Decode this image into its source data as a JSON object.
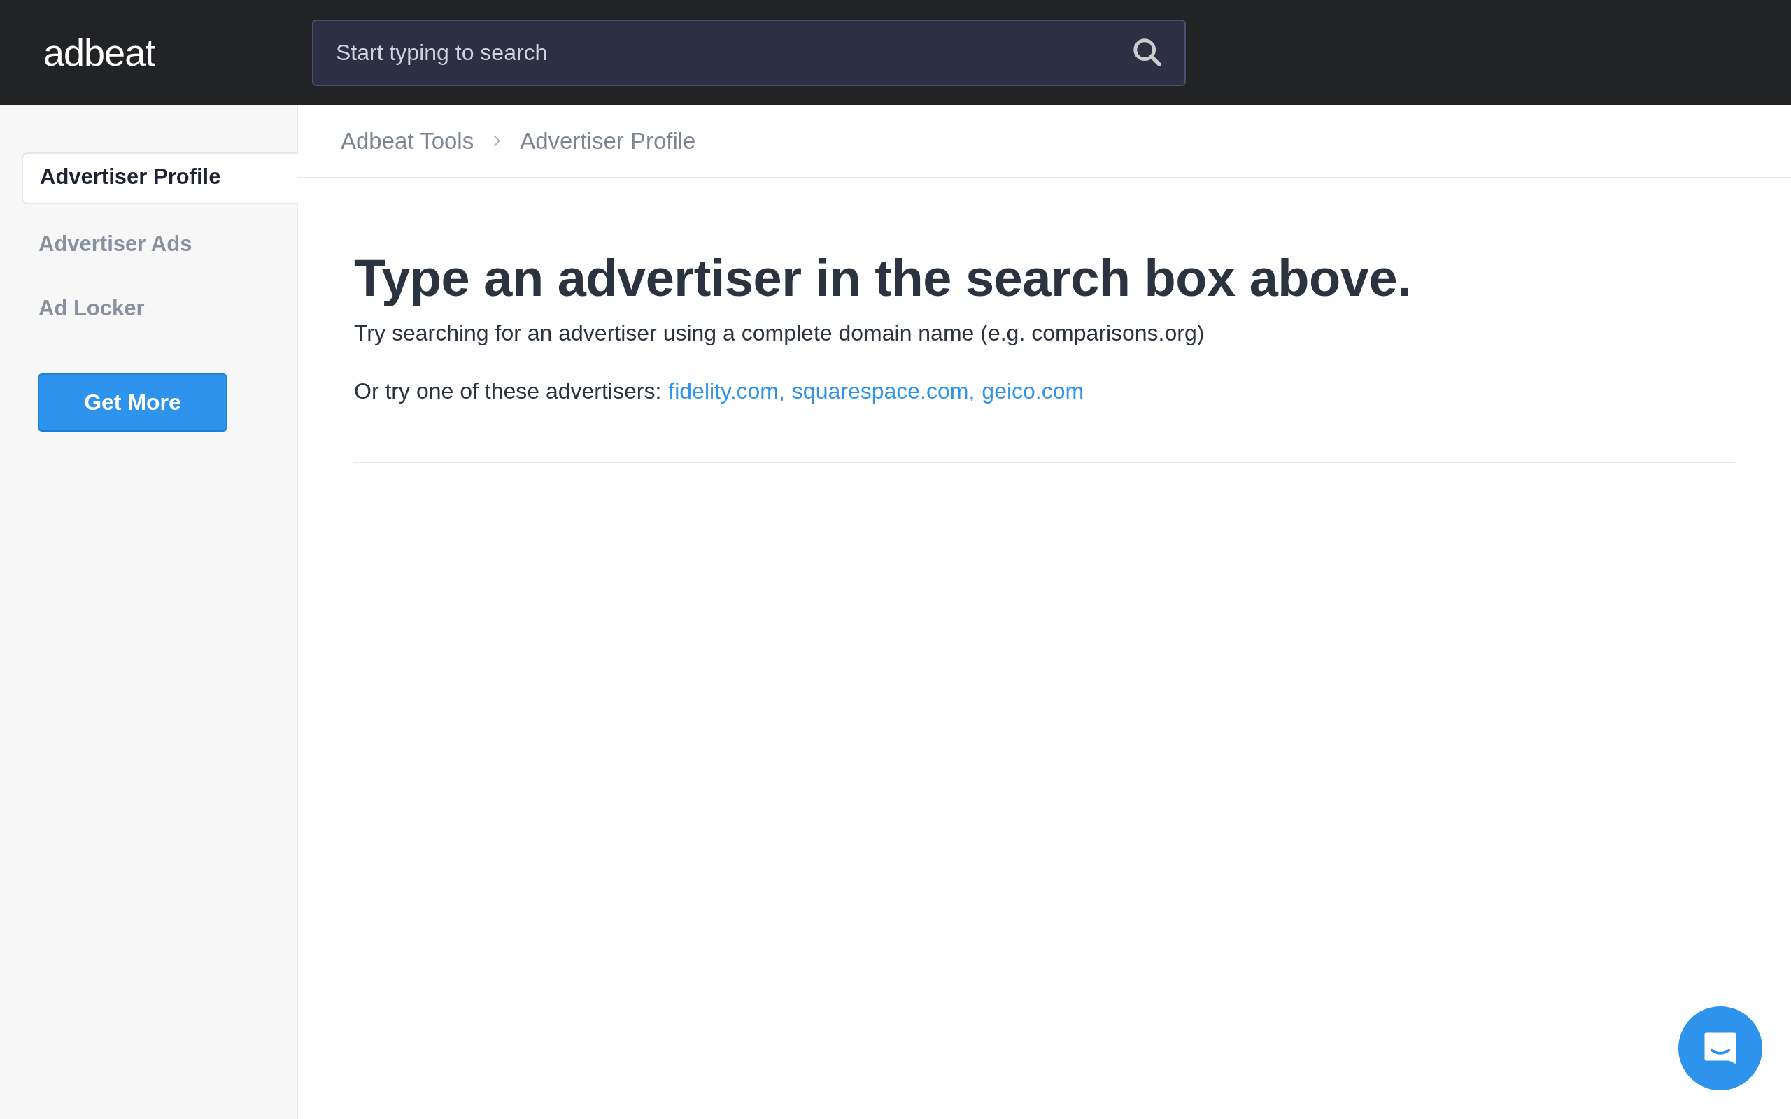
{
  "header": {
    "logo": "adbeat",
    "search": {
      "placeholder": "Start typing to search"
    }
  },
  "sidebar": {
    "items": [
      {
        "label": "Advertiser Profile",
        "selected": true
      },
      {
        "label": "Advertiser Ads",
        "selected": false
      },
      {
        "label": "Ad Locker",
        "selected": false
      }
    ],
    "button": "Get More"
  },
  "breadcrumb": [
    "Adbeat Tools",
    "Advertiser Profile"
  ],
  "content": {
    "heading": "Type an advertiser in the search box above.",
    "hint": "Try searching for an advertiser using a complete domain name (e.g. comparisons.org)",
    "suggestions_label": "Or try one of these advertisers:",
    "suggestions": [
      "fidelity.com,",
      "squarespace.com,",
      "geico.com"
    ]
  }
}
